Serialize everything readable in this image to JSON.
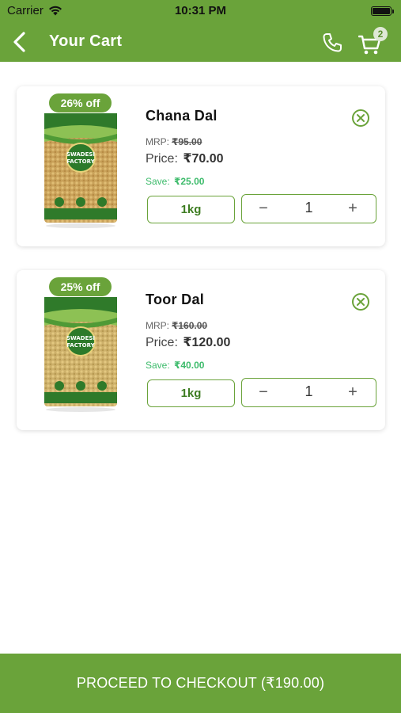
{
  "status_bar": {
    "carrier": "Carrier",
    "time": "10:31 PM"
  },
  "header": {
    "title": "Your Cart",
    "cart_count": "2"
  },
  "cart_items": [
    {
      "discount": "26% off",
      "name": "Chana Dal",
      "mrp_label": "MRP:",
      "mrp": "₹95.00",
      "price_label": "Price:",
      "price": "₹70.00",
      "save_label": "Save:",
      "save": "₹25.00",
      "weight": "1kg",
      "quantity": "1"
    },
    {
      "discount": "25% off",
      "name": "Toor Dal",
      "mrp_label": "MRP:",
      "mrp": "₹160.00",
      "price_label": "Price:",
      "price": "₹120.00",
      "save_label": "Save:",
      "save": "₹40.00",
      "weight": "1kg",
      "quantity": "1"
    }
  ],
  "stepper": {
    "minus": "−",
    "plus": "+"
  },
  "checkout": {
    "label": "PROCEED TO CHECKOUT (₹190.00)"
  },
  "packaging": {
    "brand_line1": "SWADESI",
    "brand_line2": "FACTORY"
  },
  "colors": {
    "primary": "#6aa33a",
    "save_green": "#3dbb6b"
  },
  "icons": {
    "back": "chevron-left-icon",
    "phone": "phone-icon",
    "cart": "cart-icon",
    "remove": "close-circle-icon",
    "wifi": "wifi-icon",
    "battery": "battery-icon"
  }
}
